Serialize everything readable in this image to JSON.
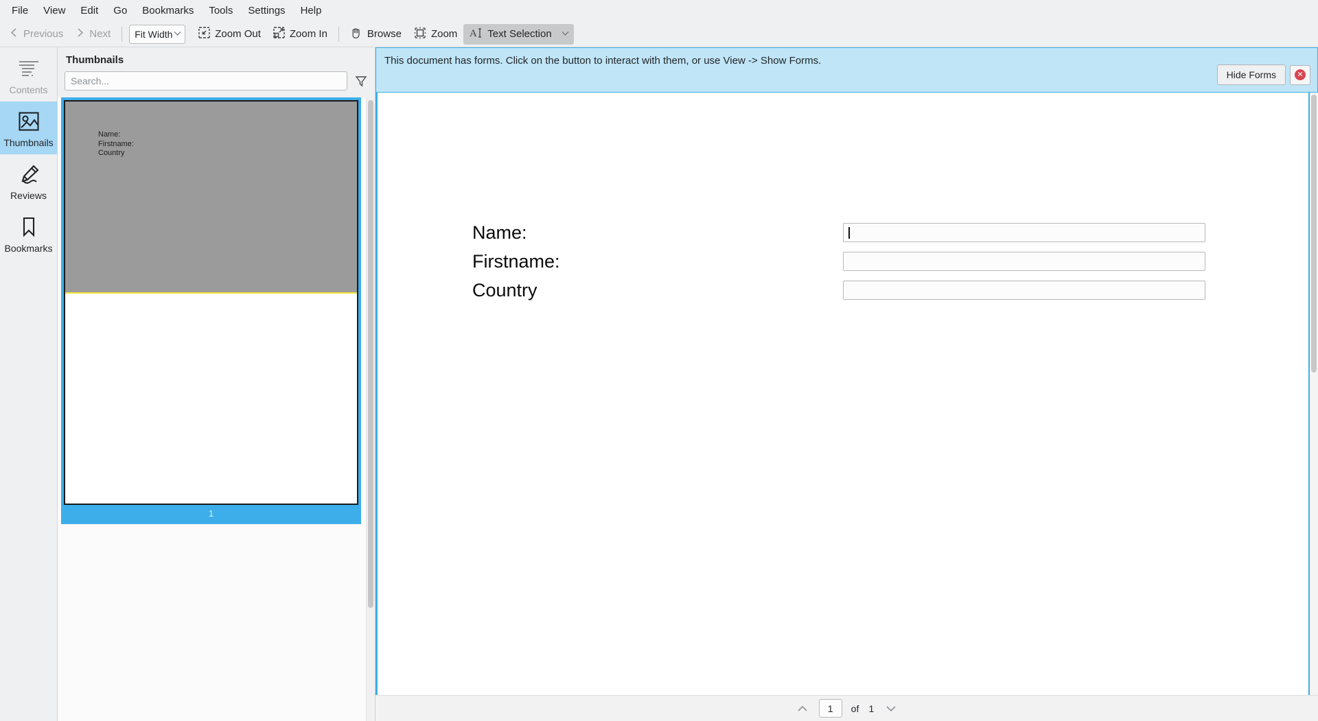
{
  "menubar": {
    "items": [
      {
        "label": "File"
      },
      {
        "label": "View"
      },
      {
        "label": "Edit"
      },
      {
        "label": "Go"
      },
      {
        "label": "Bookmarks"
      },
      {
        "label": "Tools"
      },
      {
        "label": "Settings"
      },
      {
        "label": "Help"
      }
    ]
  },
  "toolbar": {
    "previous_label": "Previous",
    "next_label": "Next",
    "zoom_combo_value": "Fit Width",
    "zoom_out_label": "Zoom Out",
    "zoom_in_label": "Zoom In",
    "browse_label": "Browse",
    "zoom_label": "Zoom",
    "text_selection_label": "Text Selection"
  },
  "rail": {
    "items": [
      {
        "label": "Contents",
        "icon": "contents-icon",
        "state": "disabled"
      },
      {
        "label": "Thumbnails",
        "icon": "thumbnails-icon",
        "state": "selected"
      },
      {
        "label": "Reviews",
        "icon": "reviews-icon",
        "state": "normal"
      },
      {
        "label": "Bookmarks",
        "icon": "bookmarks-icon",
        "state": "normal"
      }
    ]
  },
  "thumbnails_panel": {
    "title": "Thumbnails",
    "search_placeholder": "Search...",
    "filter_icon": "funnel-icon",
    "pages": [
      {
        "number": "1",
        "preview_lines": [
          "Name:",
          "Firstname:",
          "Country"
        ]
      }
    ]
  },
  "notice": {
    "message": "This document has forms. Click on the button to interact with them, or use View -> Show Forms.",
    "hide_forms_label": "Hide Forms",
    "close_icon": "close-circle-icon"
  },
  "document": {
    "fields": [
      {
        "label": "Name:",
        "value": "",
        "focused": true
      },
      {
        "label": "Firstname:",
        "value": "",
        "focused": false
      },
      {
        "label": "Country",
        "value": "",
        "focused": false
      }
    ]
  },
  "pagenav": {
    "up_icon": "chevron-up-icon",
    "down_icon": "chevron-down-icon",
    "current_page": "1",
    "of_label": "of",
    "total_pages": "1"
  },
  "colors": {
    "accent": "#3daee9",
    "selection": "#a6d7f5",
    "notice_bg": "#bfe5f7",
    "chrome": "#eff0f1",
    "close_red": "#d9434f",
    "thumb_divider": "#f2e23a"
  }
}
